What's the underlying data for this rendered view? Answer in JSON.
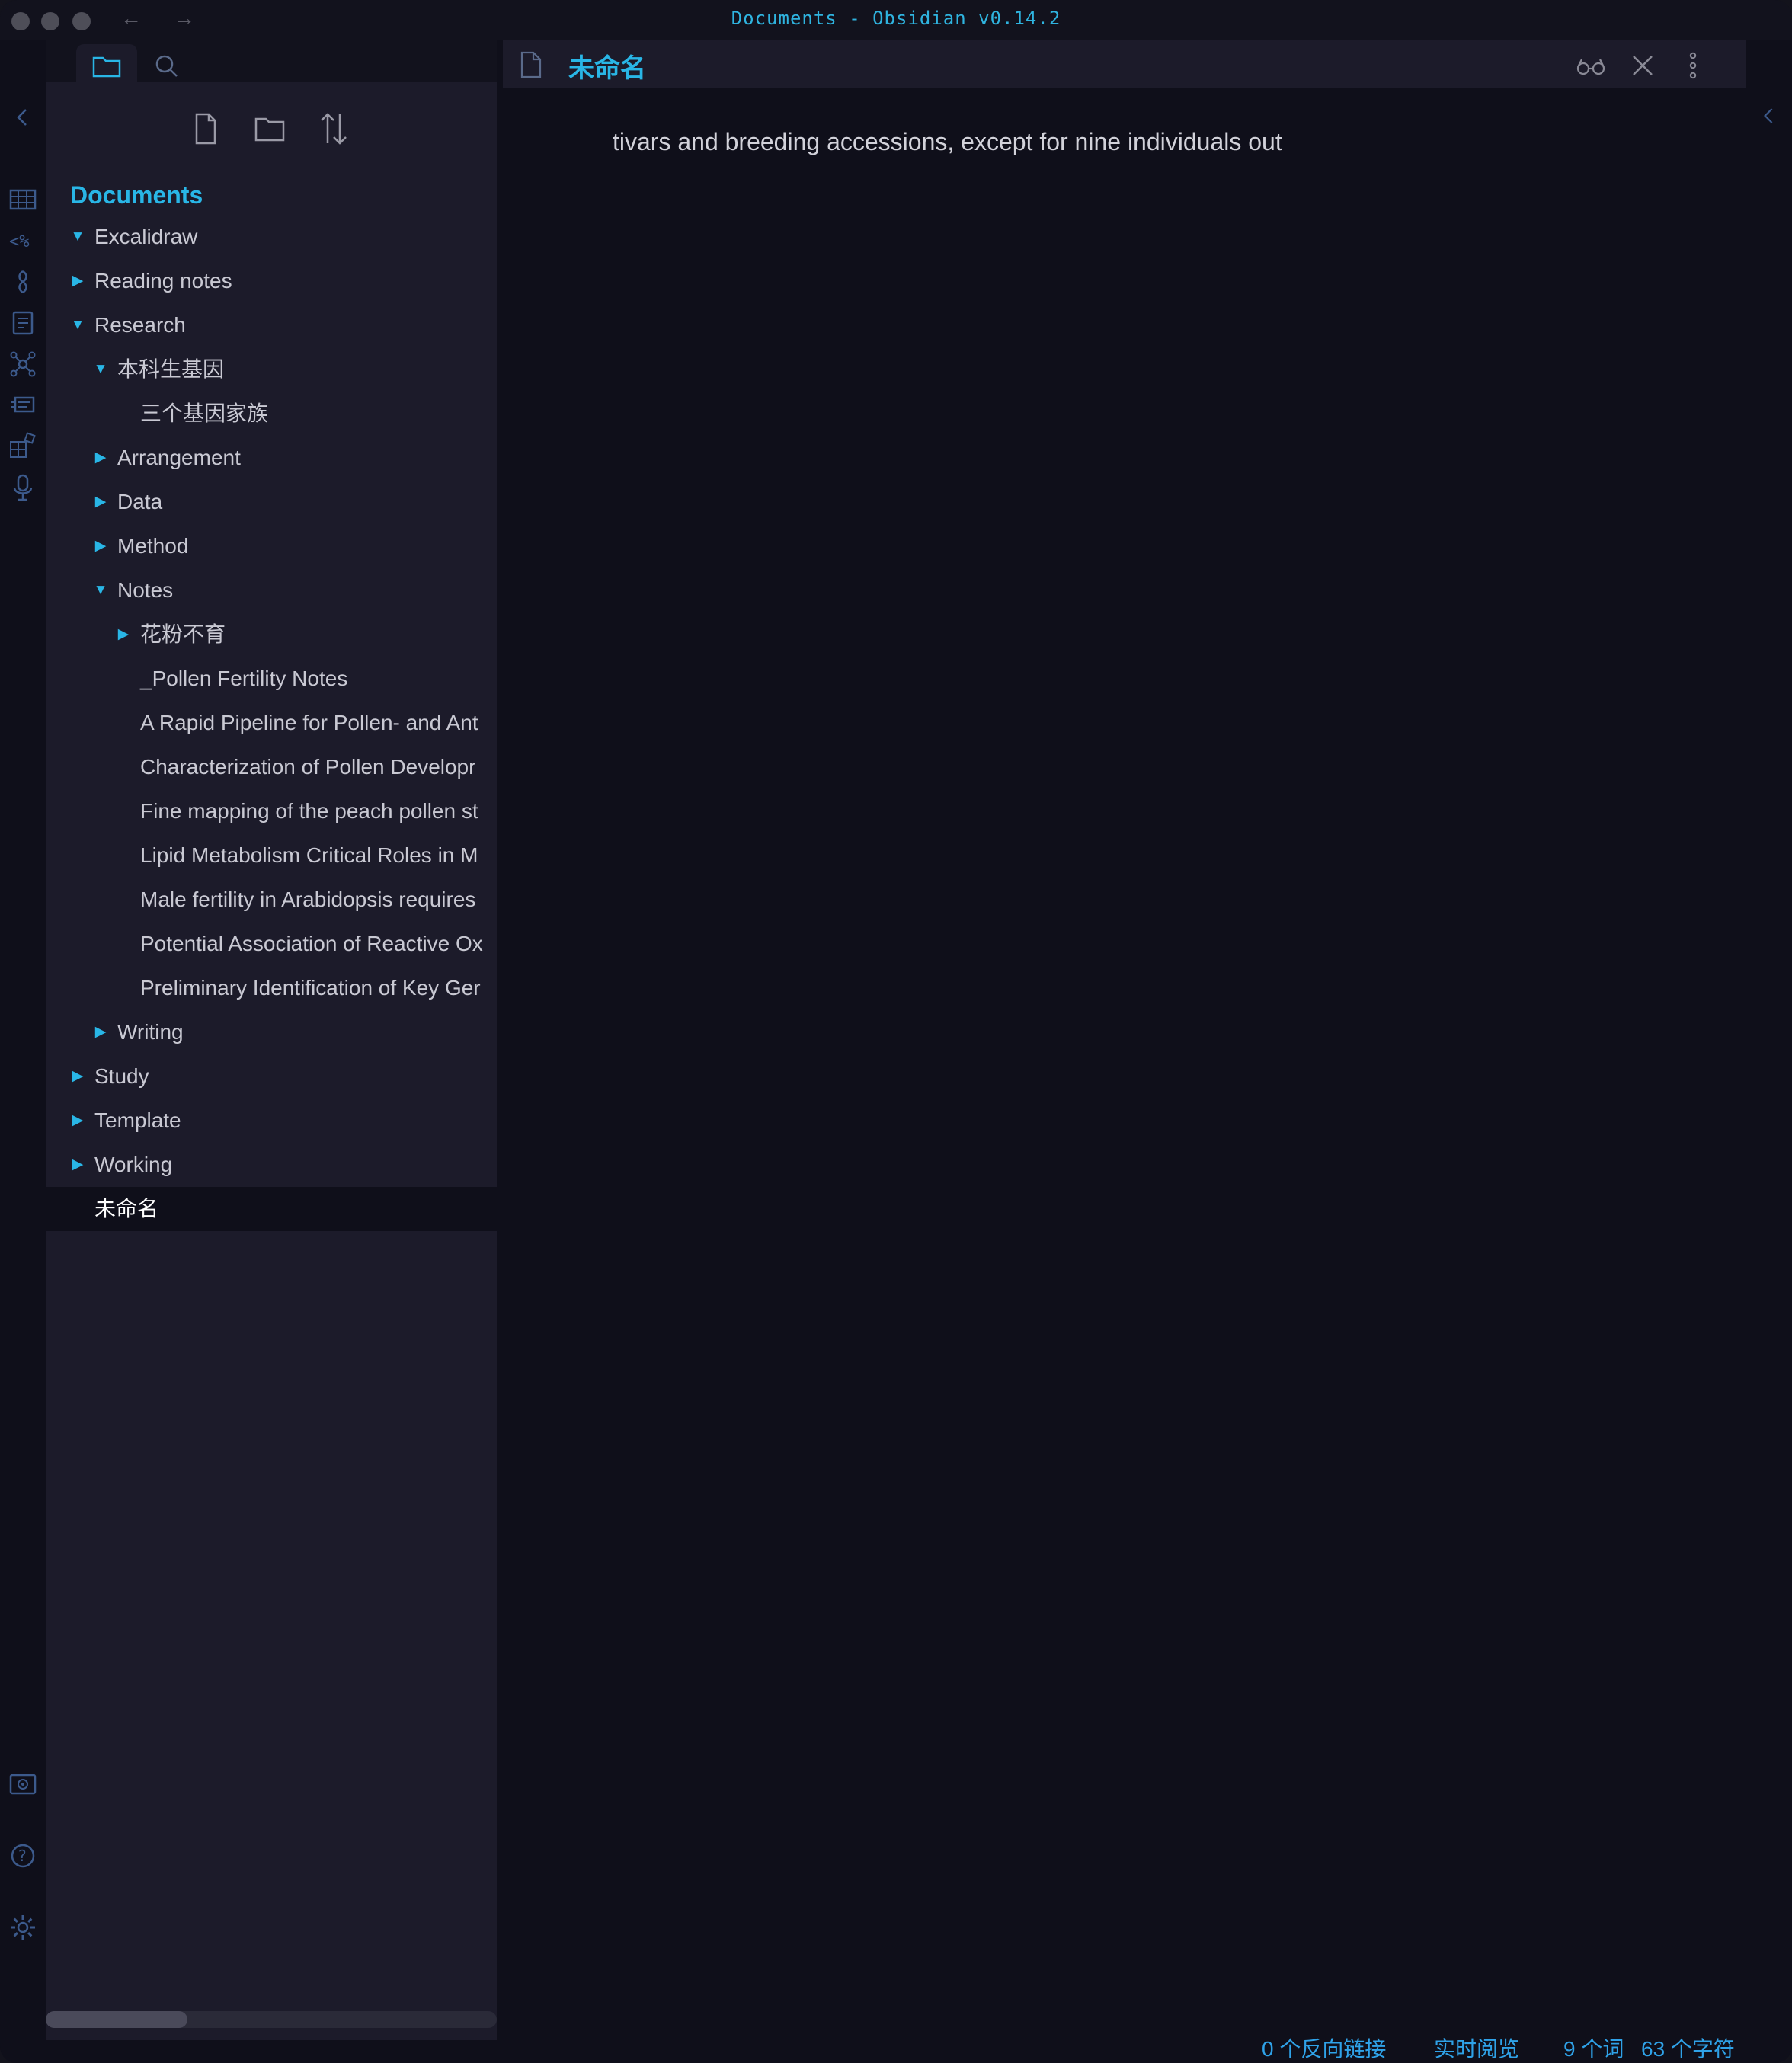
{
  "window": {
    "title": "Documents - Obsidian v0.14.2",
    "nav_back": "←",
    "nav_forward": "→"
  },
  "ribbon": {
    "collapse_icon": "chevron-left-icon",
    "items": [
      "table-icon",
      "templater-icon",
      "brain-icon",
      "calendar-icon",
      "graph-icon",
      "slides-icon",
      "plugins-icon",
      "microphone-icon"
    ],
    "bottom": [
      "vault-icon",
      "help-icon",
      "settings-icon"
    ]
  },
  "sidebar": {
    "tabs": [
      "folder-icon",
      "search-icon"
    ],
    "actions": [
      "new-note-icon",
      "new-folder-icon",
      "sort-icon"
    ],
    "vault_name": "Documents",
    "tree": [
      {
        "label": "Excalidraw",
        "level": 1,
        "state": "open"
      },
      {
        "label": "Reading notes",
        "level": 1,
        "state": "closed"
      },
      {
        "label": "Research",
        "level": 1,
        "state": "open"
      },
      {
        "label": "本科生基因",
        "level": 2,
        "state": "open"
      },
      {
        "label": "三个基因家族",
        "level": 3,
        "state": "file"
      },
      {
        "label": "Arrangement",
        "level": 2,
        "state": "closed"
      },
      {
        "label": "Data",
        "level": 2,
        "state": "closed"
      },
      {
        "label": "Method",
        "level": 2,
        "state": "closed"
      },
      {
        "label": "Notes",
        "level": 2,
        "state": "open"
      },
      {
        "label": "花粉不育",
        "level": 3,
        "state": "closed"
      },
      {
        "label": "_Pollen Fertility Notes",
        "level": 3,
        "state": "file"
      },
      {
        "label": "A Rapid Pipeline for Pollen- and Ant",
        "level": 3,
        "state": "file"
      },
      {
        "label": "Characterization of Pollen Developr",
        "level": 3,
        "state": "file"
      },
      {
        "label": "Fine mapping of the peach pollen st",
        "level": 3,
        "state": "file"
      },
      {
        "label": "Lipid Metabolism Critical Roles in M",
        "level": 3,
        "state": "file"
      },
      {
        "label": "Male fertility in Arabidopsis requires",
        "level": 3,
        "state": "file"
      },
      {
        "label": "Potential Association of Reactive Ox",
        "level": 3,
        "state": "file"
      },
      {
        "label": "Preliminary Identification of Key Ger",
        "level": 3,
        "state": "file"
      },
      {
        "label": "Writing",
        "level": 2,
        "state": "closed"
      },
      {
        "label": "Study",
        "level": 1,
        "state": "closed"
      },
      {
        "label": "Template",
        "level": 1,
        "state": "closed"
      },
      {
        "label": "Working",
        "level": 1,
        "state": "closed"
      },
      {
        "label": "未命名",
        "level": 1,
        "state": "file",
        "selected": true
      }
    ]
  },
  "editor": {
    "tab_title": "未命名",
    "header_actions": [
      "reading-view-icon",
      "close-icon",
      "more-options-icon"
    ],
    "content": "tivars and breeding accessions, except for nine individuals out"
  },
  "status_bar": {
    "backlinks": "0 个反向链接",
    "mode": "实时阅览",
    "words": "9 个词",
    "chars": "63 个字符"
  },
  "colors": {
    "accent": "#29b6e6",
    "sidebar_bg": "#1c1b2a",
    "editor_bg": "#0f0f1a",
    "status_text": "#2fa2e8"
  }
}
